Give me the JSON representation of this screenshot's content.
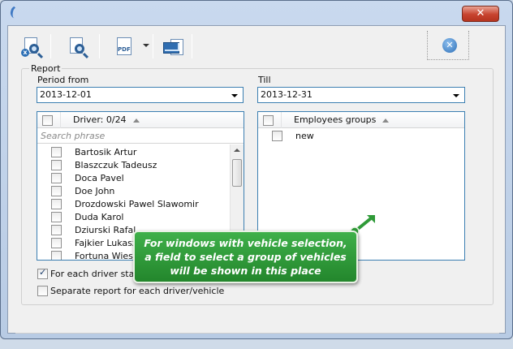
{
  "window": {
    "close_glyph": "✕"
  },
  "toolbar": {
    "buttons": [
      {
        "icon": "clear-search-icon"
      },
      {
        "icon": "preview-search-icon"
      },
      {
        "icon": "pdf-icon",
        "label": "PDF"
      },
      {
        "icon": "email-icon"
      }
    ],
    "close_glyph": "✕"
  },
  "report": {
    "group_title": "Report",
    "period_from_label": "Period from",
    "period_from_value": "2013-12-01",
    "till_label": "Till",
    "till_value": "2013-12-31"
  },
  "drivers": {
    "header": "Driver: 0/24",
    "search_placeholder": "Search phrase",
    "items": [
      "Bartosik Artur",
      "Blaszczuk Tadeusz",
      "Doca Pavel",
      "Doe John",
      "Drozdowski Pawel Slawomir",
      "Duda Karol",
      "Dziurski Rafal",
      "Fajkier Lukasz",
      "Fortuna Wieslaw"
    ]
  },
  "employees_groups": {
    "header": "Employees groups",
    "items": [
      "new"
    ]
  },
  "options": {
    "each_driver_start": "For each driver start p",
    "each_driver_start_checked": true,
    "separate_report": "Separate report for each driver/vehicle",
    "separate_report_checked": false
  },
  "callout": {
    "line1": "For windows with vehicle selection,",
    "line2": "a field to select a group of vehicles",
    "line3": "will be shown in this place"
  },
  "colors": {
    "callout_green": "#2f9a38",
    "accent_blue": "#3c7fb1"
  }
}
